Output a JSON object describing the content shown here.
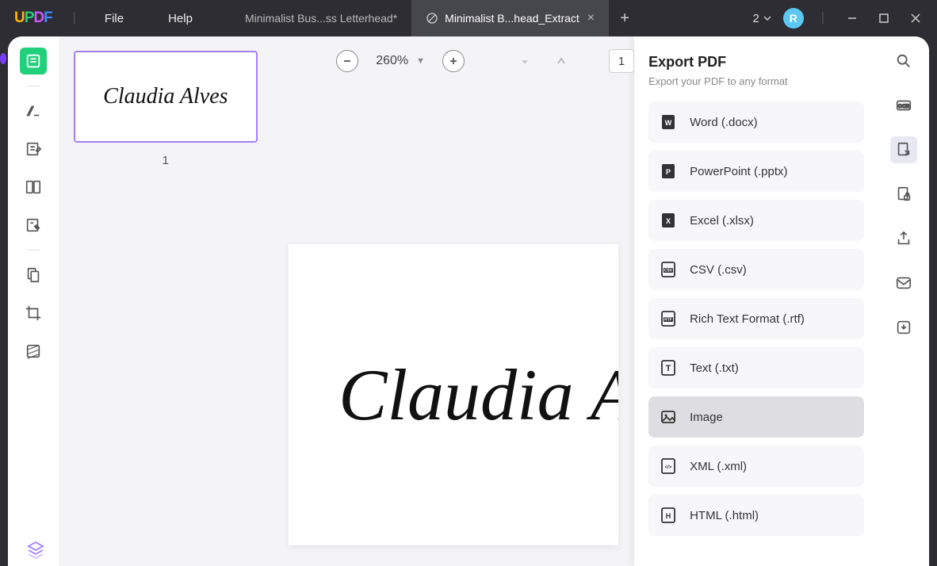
{
  "app": {
    "logo": "UPDF"
  },
  "menu": {
    "file": "File",
    "help": "Help"
  },
  "tabs": {
    "items": [
      {
        "label": "Minimalist Bus...ss Letterhead*"
      },
      {
        "label": "Minimalist B...head_Extract"
      }
    ]
  },
  "titlebar": {
    "windowcount": "2",
    "avatar": "R"
  },
  "zoom": {
    "percent": "260%",
    "currentpage": "1"
  },
  "thumbs": {
    "pagenum": "1",
    "preview_text": "Claudia Alves"
  },
  "document": {
    "text": "Claudia Alves"
  },
  "export": {
    "title": "Export PDF",
    "subtitle": "Export your PDF to any format",
    "items": [
      {
        "label": "Word (.docx)"
      },
      {
        "label": "PowerPoint (.pptx)"
      },
      {
        "label": "Excel (.xlsx)"
      },
      {
        "label": "CSV (.csv)"
      },
      {
        "label": "Rich Text Format (.rtf)"
      },
      {
        "label": "Text (.txt)"
      },
      {
        "label": "Image"
      },
      {
        "label": "XML (.xml)"
      },
      {
        "label": "HTML (.html)"
      }
    ]
  }
}
